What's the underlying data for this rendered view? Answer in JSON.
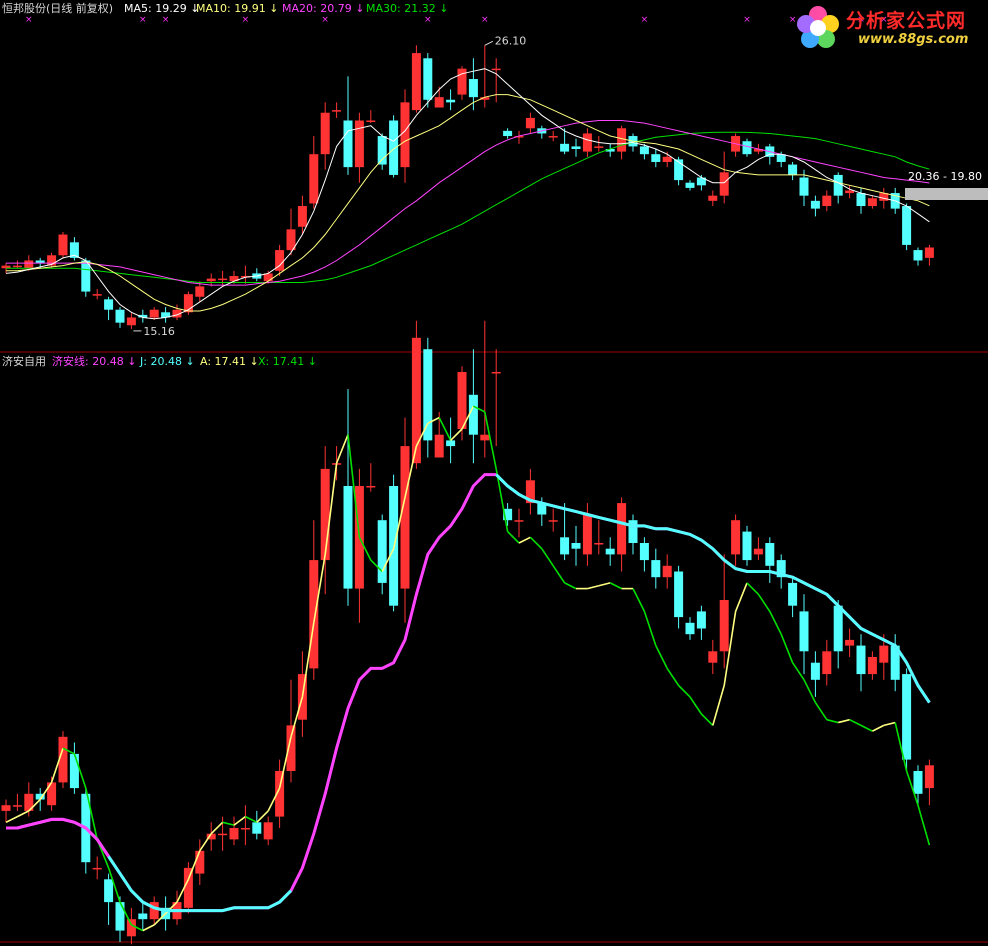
{
  "colors": {
    "background": "#000000",
    "up": "#ff3333",
    "down": "#54ffff",
    "ma5": "#ffffff",
    "ma10": "#ffff80",
    "ma20": "#ff44ff",
    "ma30": "#00e000",
    "axis": "#a00000",
    "price_box": "#bdbdbd"
  },
  "top_panel": {
    "title": "恒邦股份(日线 前复权)",
    "legend": [
      {
        "name": "MA5",
        "value": "19.29",
        "color": "#ffffff"
      },
      {
        "name": "MA10",
        "value": "19.91",
        "color": "#ffff80"
      },
      {
        "name": "MA20",
        "value": "20.79",
        "color": "#ff44ff"
      },
      {
        "name": "MA30",
        "value": "21.32",
        "color": "#00e000"
      }
    ],
    "high_label": "26.10",
    "low_label": "15.16",
    "price_box_label": "20.36 - 19.80"
  },
  "bottom_panel": {
    "title": "济安自用",
    "legend": [
      {
        "name": "济安线",
        "value": "20.48",
        "color": "#ff44ff"
      },
      {
        "name": "J",
        "value": "20.48",
        "color": "#54ffff"
      },
      {
        "name": "A",
        "value": "17.41",
        "color": "#ffff80"
      },
      {
        "name": "X",
        "value": "17.41",
        "color": "#00e000"
      }
    ]
  },
  "watermark": {
    "title": "分析家公式网",
    "url": "www.88gs.com"
  },
  "chart_data": {
    "type": "candlestick",
    "ylim_top_panel": [
      14.5,
      27.0
    ],
    "ylim_bottom_panel": [
      15.2,
      25.2
    ],
    "candles": [
      [
        17.5,
        17.6,
        17.3,
        17.7
      ],
      [
        17.6,
        17.6,
        17.5,
        17.8
      ],
      [
        17.5,
        17.8,
        17.4,
        18.0
      ],
      [
        17.8,
        17.7,
        17.5,
        17.9
      ],
      [
        17.6,
        18.0,
        17.5,
        18.1
      ],
      [
        18.0,
        18.8,
        17.9,
        18.9
      ],
      [
        18.5,
        17.9,
        17.8,
        18.7
      ],
      [
        17.8,
        16.6,
        16.4,
        17.9
      ],
      [
        16.5,
        16.5,
        16.3,
        16.7
      ],
      [
        16.3,
        15.9,
        15.5,
        16.4
      ],
      [
        15.9,
        15.4,
        15.2,
        16.0
      ],
      [
        15.3,
        15.6,
        15.16,
        15.8
      ],
      [
        15.7,
        15.6,
        15.4,
        15.9
      ],
      [
        15.6,
        15.9,
        15.5,
        16.0
      ],
      [
        15.8,
        15.6,
        15.4,
        16.0
      ],
      [
        15.6,
        15.9,
        15.5,
        16.1
      ],
      [
        15.8,
        16.5,
        15.7,
        16.6
      ],
      [
        16.4,
        16.8,
        16.2,
        17.0
      ],
      [
        17.0,
        17.1,
        16.8,
        17.3
      ],
      [
        17.1,
        17.1,
        16.8,
        17.4
      ],
      [
        17.0,
        17.2,
        16.9,
        17.4
      ],
      [
        17.2,
        17.2,
        16.9,
        17.6
      ],
      [
        17.3,
        17.1,
        17.0,
        17.5
      ],
      [
        17.0,
        17.3,
        16.9,
        17.4
      ],
      [
        17.4,
        18.2,
        17.2,
        18.4
      ],
      [
        18.2,
        19.0,
        18.0,
        19.8
      ],
      [
        19.1,
        19.9,
        18.8,
        20.3
      ],
      [
        20.0,
        21.9,
        19.8,
        22.6
      ],
      [
        21.9,
        23.5,
        21.3,
        23.9
      ],
      [
        23.6,
        23.6,
        23.3,
        23.9
      ],
      [
        23.2,
        21.4,
        21.1,
        24.9
      ],
      [
        21.4,
        23.2,
        20.8,
        23.5
      ],
      [
        23.2,
        23.2,
        23.1,
        23.6
      ],
      [
        22.6,
        21.5,
        21.3,
        22.7
      ],
      [
        23.2,
        21.1,
        21.0,
        23.4
      ],
      [
        21.4,
        23.9,
        20.8,
        24.4
      ],
      [
        23.6,
        25.8,
        23.5,
        26.1
      ],
      [
        25.6,
        24.0,
        23.7,
        25.8
      ],
      [
        23.7,
        24.1,
        23.8,
        24.5
      ],
      [
        24.0,
        23.9,
        23.6,
        24.4
      ],
      [
        24.2,
        25.2,
        24.0,
        25.3
      ],
      [
        24.8,
        24.1,
        23.6,
        25.6
      ],
      [
        24.0,
        24.1,
        23.7,
        26.1
      ],
      [
        25.2,
        25.2,
        23.9,
        25.6
      ],
      [
        22.8,
        22.6,
        22.5,
        22.9
      ],
      [
        22.6,
        22.6,
        22.3,
        22.8
      ],
      [
        22.9,
        23.3,
        22.7,
        23.5
      ],
      [
        22.9,
        22.7,
        22.5,
        23.0
      ],
      [
        22.6,
        22.6,
        22.4,
        22.8
      ],
      [
        22.3,
        22.0,
        21.9,
        22.9
      ],
      [
        22.2,
        22.1,
        21.8,
        22.5
      ],
      [
        22.0,
        22.7,
        21.8,
        22.9
      ],
      [
        22.2,
        22.2,
        22.0,
        22.6
      ],
      [
        22.1,
        22.0,
        21.8,
        22.3
      ],
      [
        22.0,
        22.9,
        21.7,
        23.0
      ],
      [
        22.6,
        22.2,
        22.0,
        22.7
      ],
      [
        22.2,
        21.9,
        21.7,
        22.3
      ],
      [
        21.9,
        21.6,
        21.4,
        22.1
      ],
      [
        21.6,
        21.8,
        21.4,
        22.0
      ],
      [
        21.7,
        20.9,
        20.7,
        21.8
      ],
      [
        20.8,
        20.6,
        20.5,
        20.9
      ],
      [
        21.0,
        20.7,
        20.5,
        21.1
      ],
      [
        20.1,
        20.3,
        19.9,
        20.5
      ],
      [
        20.3,
        21.2,
        20.0,
        22.0
      ],
      [
        22.0,
        22.6,
        21.8,
        22.7
      ],
      [
        22.4,
        21.9,
        21.8,
        22.5
      ],
      [
        22.0,
        22.1,
        21.9,
        22.3
      ],
      [
        22.2,
        21.8,
        21.5,
        22.3
      ],
      [
        21.9,
        21.6,
        21.4,
        22.0
      ],
      [
        21.5,
        21.1,
        20.9,
        21.6
      ],
      [
        21.0,
        20.3,
        19.9,
        21.3
      ],
      [
        20.1,
        19.8,
        19.5,
        20.3
      ],
      [
        19.9,
        20.3,
        19.7,
        20.5
      ],
      [
        21.1,
        20.3,
        20.0,
        21.2
      ],
      [
        20.4,
        20.5,
        20.2,
        20.7
      ],
      [
        20.4,
        19.9,
        19.6,
        20.6
      ],
      [
        19.9,
        20.2,
        19.8,
        20.3
      ],
      [
        20.1,
        20.4,
        19.8,
        20.6
      ],
      [
        20.4,
        19.8,
        19.6,
        20.6
      ],
      [
        19.9,
        18.4,
        18.2,
        20.0
      ],
      [
        18.2,
        17.8,
        17.6,
        18.3
      ],
      [
        17.9,
        18.3,
        17.6,
        18.4
      ]
    ],
    "ma5": [
      17.3,
      17.35,
      17.45,
      17.55,
      17.65,
      17.9,
      18.0,
      17.8,
      17.2,
      16.6,
      16.1,
      15.8,
      15.6,
      15.55,
      15.6,
      15.7,
      15.9,
      16.2,
      16.5,
      16.8,
      17.0,
      17.15,
      17.2,
      17.3,
      17.6,
      18.1,
      18.8,
      19.7,
      20.9,
      22.2,
      22.8,
      22.9,
      23.0,
      22.6,
      22.4,
      22.8,
      23.4,
      23.9,
      24.4,
      24.8,
      25.0,
      25.1,
      25.2,
      25.0,
      24.6,
      24.2,
      23.8,
      23.4,
      23.1,
      22.8,
      22.6,
      22.45,
      22.35,
      22.3,
      22.3,
      22.35,
      22.25,
      22.1,
      21.9,
      21.6,
      21.3,
      21.0,
      20.8,
      20.8,
      21.2,
      21.4,
      21.7,
      21.9,
      21.9,
      21.8,
      21.6,
      21.3,
      21.0,
      20.8,
      20.55,
      20.4,
      20.3,
      20.2,
      20.1,
      19.9,
      19.6,
      19.29
    ],
    "ma10": [
      17.4,
      17.4,
      17.45,
      17.5,
      17.55,
      17.6,
      17.7,
      17.75,
      17.65,
      17.45,
      17.2,
      16.9,
      16.6,
      16.3,
      16.1,
      15.95,
      15.85,
      15.85,
      15.95,
      16.1,
      16.3,
      16.5,
      16.75,
      17.0,
      17.3,
      17.6,
      17.9,
      18.3,
      18.8,
      19.4,
      20.0,
      20.6,
      21.2,
      21.7,
      22.1,
      22.4,
      22.6,
      22.8,
      23.0,
      23.3,
      23.6,
      23.9,
      24.1,
      24.2,
      24.2,
      24.1,
      24.0,
      23.8,
      23.6,
      23.4,
      23.2,
      23.0,
      22.8,
      22.6,
      22.5,
      22.4,
      22.35,
      22.3,
      22.2,
      22.1,
      21.9,
      21.7,
      21.5,
      21.3,
      21.2,
      21.15,
      21.1,
      21.1,
      21.1,
      21.1,
      21.1,
      21.0,
      20.9,
      20.8,
      20.7,
      20.6,
      20.5,
      20.4,
      20.3,
      20.2,
      20.1,
      19.91
    ],
    "ma20": [
      17.7,
      17.7,
      17.7,
      17.7,
      17.7,
      17.7,
      17.7,
      17.7,
      17.65,
      17.6,
      17.55,
      17.45,
      17.35,
      17.25,
      17.15,
      17.05,
      16.95,
      16.9,
      16.85,
      16.85,
      16.85,
      16.85,
      16.9,
      16.95,
      17.0,
      17.1,
      17.2,
      17.35,
      17.55,
      17.8,
      18.1,
      18.4,
      18.75,
      19.1,
      19.45,
      19.8,
      20.1,
      20.45,
      20.8,
      21.1,
      21.4,
      21.7,
      22.0,
      22.25,
      22.45,
      22.6,
      22.7,
      22.8,
      22.9,
      23.0,
      23.1,
      23.15,
      23.2,
      23.2,
      23.2,
      23.15,
      23.1,
      23.0,
      22.9,
      22.8,
      22.7,
      22.6,
      22.5,
      22.4,
      22.3,
      22.2,
      22.1,
      22.0,
      21.9,
      21.8,
      21.7,
      21.6,
      21.5,
      21.4,
      21.3,
      21.2,
      21.1,
      21.0,
      20.95,
      20.9,
      20.85,
      20.79
    ],
    "ma30": [
      17.5,
      17.5,
      17.5,
      17.5,
      17.5,
      17.5,
      17.5,
      17.45,
      17.4,
      17.35,
      17.3,
      17.25,
      17.2,
      17.15,
      17.1,
      17.05,
      17.0,
      16.95,
      16.95,
      16.95,
      16.95,
      16.95,
      16.95,
      16.95,
      16.95,
      16.95,
      16.95,
      17.0,
      17.05,
      17.15,
      17.3,
      17.45,
      17.6,
      17.8,
      18.0,
      18.2,
      18.4,
      18.6,
      18.8,
      19.0,
      19.2,
      19.45,
      19.7,
      19.95,
      20.2,
      20.45,
      20.7,
      20.95,
      21.15,
      21.35,
      21.55,
      21.75,
      21.95,
      22.1,
      22.25,
      22.35,
      22.45,
      22.55,
      22.6,
      22.65,
      22.7,
      22.72,
      22.74,
      22.75,
      22.75,
      22.74,
      22.72,
      22.7,
      22.65,
      22.6,
      22.55,
      22.5,
      22.4,
      22.3,
      22.2,
      22.1,
      22.0,
      21.9,
      21.8,
      21.6,
      21.45,
      21.32
    ],
    "jian_line": [
      17.2,
      17.2,
      17.25,
      17.3,
      17.35,
      17.35,
      17.3,
      17.2,
      17.0,
      16.7,
      16.4,
      16.1,
      15.9,
      15.8,
      15.75,
      15.75,
      15.75,
      15.75,
      15.75,
      15.75,
      15.8,
      15.8,
      15.8,
      15.8,
      15.9,
      16.1,
      16.5,
      17.1,
      17.8,
      18.6,
      19.3,
      19.8,
      20.0,
      20.0,
      20.1,
      20.5,
      21.3,
      22.0,
      22.3,
      22.5,
      22.8,
      23.2,
      23.4,
      23.4,
      23.2,
      23.05,
      22.95,
      22.9,
      22.85,
      22.8,
      22.75,
      22.7,
      22.65,
      22.6,
      22.55,
      22.5,
      22.5,
      22.45,
      22.45,
      22.4,
      22.35,
      22.25,
      22.1,
      21.9,
      21.75,
      21.7,
      21.7,
      21.7,
      21.65,
      21.6,
      21.5,
      21.4,
      21.3,
      21.1,
      20.9,
      20.7,
      20.6,
      20.5,
      20.4,
      20.1,
      19.7,
      19.4
    ],
    "ax_line": [
      17.3,
      17.4,
      17.5,
      17.7,
      18.0,
      18.6,
      18.5,
      17.9,
      17.0,
      16.5,
      15.9,
      15.5,
      15.4,
      15.5,
      15.7,
      15.9,
      16.3,
      16.8,
      17.1,
      17.3,
      17.25,
      17.4,
      17.3,
      17.5,
      17.9,
      18.8,
      19.5,
      20.8,
      22.0,
      23.6,
      24.1,
      22.3,
      21.9,
      21.7,
      22.1,
      23.0,
      23.9,
      24.3,
      24.4,
      24.0,
      24.2,
      24.6,
      24.5,
      23.5,
      22.4,
      22.2,
      22.3,
      22.1,
      21.8,
      21.5,
      21.4,
      21.4,
      21.45,
      21.5,
      21.4,
      21.4,
      21.0,
      20.4,
      20.0,
      19.7,
      19.5,
      19.2,
      19.0,
      19.7,
      21.0,
      21.5,
      21.3,
      21.0,
      20.6,
      20.1,
      19.8,
      19.4,
      19.1,
      19.05,
      19.1,
      19.0,
      18.9,
      19.0,
      19.05,
      18.2,
      17.6,
      16.9
    ]
  }
}
